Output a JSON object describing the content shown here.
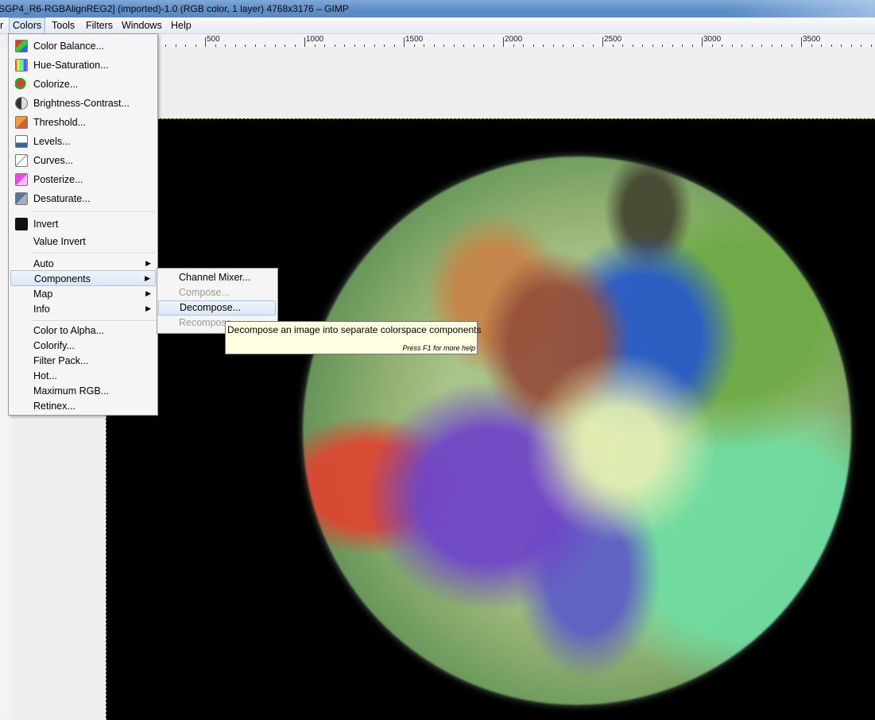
{
  "window": {
    "title": "SGP4_R6-RGBAlignREG2] (imported)-1.0 (RGB color, 1 layer) 4768x3176 – GIMP"
  },
  "menubar": {
    "items": [
      {
        "label": "r"
      },
      {
        "label": "Colors"
      },
      {
        "label": "Tools"
      },
      {
        "label": "Filters"
      },
      {
        "label": "Windows"
      },
      {
        "label": "Help"
      }
    ]
  },
  "ruler": {
    "labels": [
      "500",
      "1000",
      "1500",
      "2000",
      "2500",
      "3000",
      "3500"
    ]
  },
  "colors_menu": {
    "items": [
      {
        "label": "Color Balance...",
        "icon": "color-balance-icon"
      },
      {
        "label": "Hue-Saturation...",
        "icon": "hue-saturation-icon"
      },
      {
        "label": "Colorize...",
        "icon": "colorize-icon"
      },
      {
        "label": "Brightness-Contrast...",
        "icon": "brightness-contrast-icon"
      },
      {
        "label": "Threshold...",
        "icon": "threshold-icon"
      },
      {
        "label": "Levels...",
        "icon": "levels-icon"
      },
      {
        "label": "Curves...",
        "icon": "curves-icon"
      },
      {
        "label": "Posterize...",
        "icon": "posterize-icon"
      },
      {
        "label": "Desaturate...",
        "icon": "desaturate-icon"
      },
      {
        "label": "Invert",
        "icon": "invert-icon"
      },
      {
        "label": "Value Invert"
      },
      {
        "label": "Auto"
      },
      {
        "label": "Components"
      },
      {
        "label": "Map"
      },
      {
        "label": "Info"
      },
      {
        "label": "Color to Alpha..."
      },
      {
        "label": "Colorify..."
      },
      {
        "label": "Filter Pack..."
      },
      {
        "label": "Hot..."
      },
      {
        "label": "Maximum RGB..."
      },
      {
        "label": "Retinex..."
      }
    ]
  },
  "components_submenu": {
    "items": [
      {
        "label": "Channel Mixer...",
        "enabled": true
      },
      {
        "label": "Compose...",
        "enabled": false
      },
      {
        "label": "Decompose...",
        "enabled": true
      },
      {
        "label": "Recompose",
        "enabled": false
      }
    ]
  },
  "tooltip": {
    "text": "Decompose an image into separate colorspace components",
    "help": "Press F1 for more help"
  }
}
